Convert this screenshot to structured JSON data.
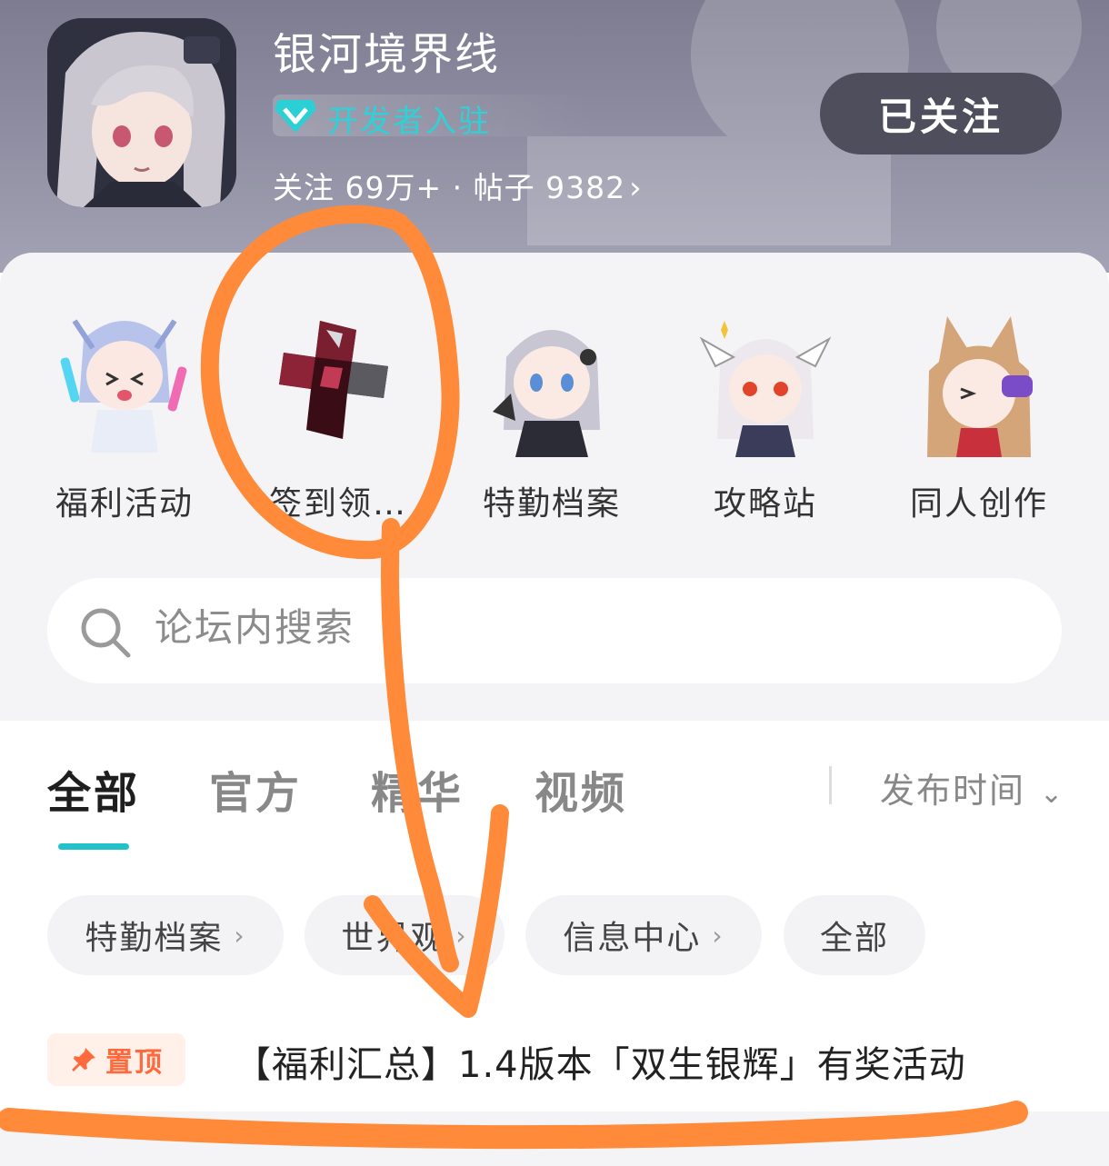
{
  "header": {
    "title": "银河境界线",
    "developer_badge": "开发者入驻",
    "stats_text": "关注 69万+ · 帖子 9382",
    "follow_button": "已关注",
    "chevron": "›"
  },
  "shortcuts": [
    {
      "label": "福利活动",
      "icon": "glowstick-chibi-girl"
    },
    {
      "label": "签到领…",
      "icon": "red-crystal-cross"
    },
    {
      "label": "特勤档案",
      "icon": "silver-hair-chibi-girl"
    },
    {
      "label": "攻略站",
      "icon": "winged-white-hair-chibi"
    },
    {
      "label": "同人创作",
      "icon": "fox-ear-chibi-girl"
    }
  ],
  "search": {
    "placeholder": "论坛内搜索"
  },
  "tabs": {
    "items": [
      "全部",
      "官方",
      "精华",
      "视频"
    ],
    "active_index": 0,
    "sort_label": "发布时间",
    "sort_chevron": "⌄"
  },
  "chips": [
    {
      "label": "特勤档案",
      "has_chevron": true
    },
    {
      "label": "世界观",
      "has_chevron": true
    },
    {
      "label": "信息中心",
      "has_chevron": true
    },
    {
      "label": "全部",
      "has_chevron": false
    }
  ],
  "pinned_post": {
    "tag": "置顶",
    "title": "【福利汇总】1.4版本「双生银辉」有奖活动"
  },
  "colors": {
    "accent_teal": "#23c1c9",
    "pin_orange": "#ff6a3d",
    "annotation_orange": "#ff8a3a"
  }
}
